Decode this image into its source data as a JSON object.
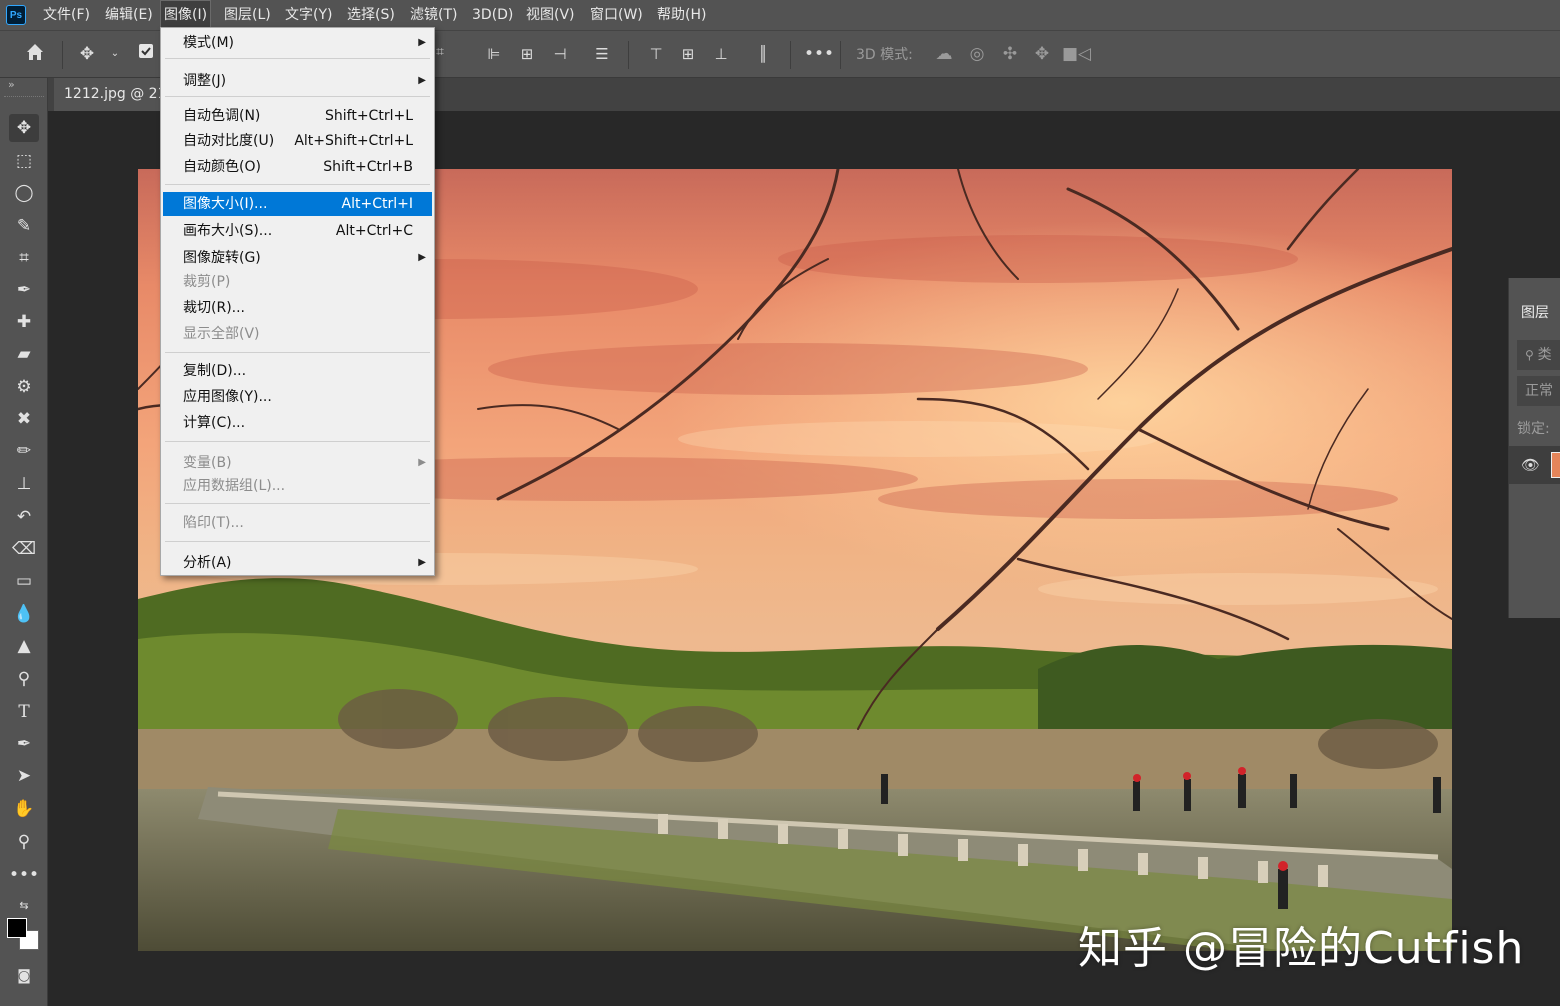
{
  "menubar": {
    "logo": "Ps",
    "items": [
      "文件(F)",
      "编辑(E)",
      "图像(I)",
      "图层(L)",
      "文字(Y)",
      "选择(S)",
      "滤镜(T)",
      "3D(D)",
      "视图(V)",
      "窗口(W)",
      "帮助(H)"
    ],
    "open_item": "图像(I)"
  },
  "optionsbar": {
    "mode_3d_label": "3D 模式:",
    "partial_text": "⌗"
  },
  "document": {
    "tab_title": "1212.jpg @ 21"
  },
  "watermark": "知乎 @冒险的Cutfish",
  "layers_panel": {
    "tab": "图层",
    "search_placeholder": "类",
    "blend_mode": "正常",
    "lock_label": "锁定:"
  },
  "image_menu": {
    "items": [
      {
        "label": "模式(M)",
        "submenu": true
      },
      {
        "label": "调整(J)",
        "submenu": true
      },
      {
        "label": "自动色调(N)",
        "shortcut": "Shift+Ctrl+L"
      },
      {
        "label": "自动对比度(U)",
        "shortcut": "Alt+Shift+Ctrl+L"
      },
      {
        "label": "自动颜色(O)",
        "shortcut": "Shift+Ctrl+B"
      },
      {
        "label": "图像大小(I)...",
        "shortcut": "Alt+Ctrl+I",
        "highlighted": true
      },
      {
        "label": "画布大小(S)...",
        "shortcut": "Alt+Ctrl+C"
      },
      {
        "label": "图像旋转(G)",
        "submenu": true
      },
      {
        "label": "裁剪(P)",
        "disabled": true
      },
      {
        "label": "裁切(R)..."
      },
      {
        "label": "显示全部(V)",
        "disabled": true
      },
      {
        "label": "复制(D)..."
      },
      {
        "label": "应用图像(Y)..."
      },
      {
        "label": "计算(C)..."
      },
      {
        "label": "变量(B)",
        "submenu": true,
        "disabled": true
      },
      {
        "label": "应用数据组(L)...",
        "disabled": true
      },
      {
        "label": "陷印(T)...",
        "disabled": true
      },
      {
        "label": "分析(A)",
        "submenu": true
      }
    ]
  },
  "colors": {
    "accent": "#0078d7",
    "chrome": "#535353",
    "canvas_bg": "#282828"
  }
}
